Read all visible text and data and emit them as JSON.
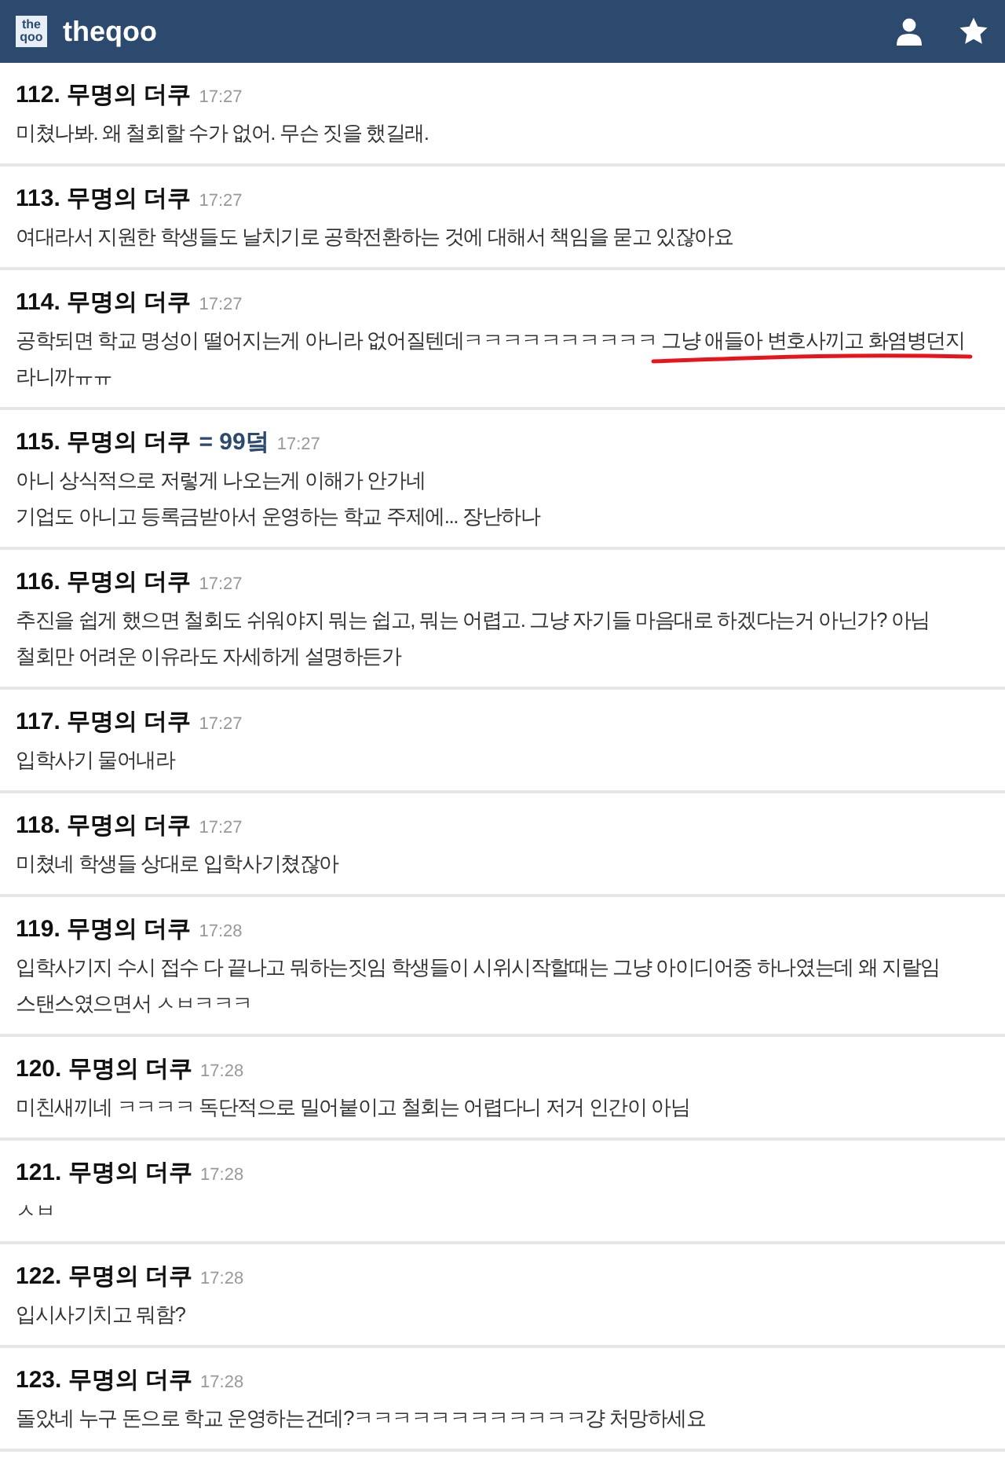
{
  "header": {
    "logo": "the qoo",
    "title": "theqoo"
  },
  "comments": [
    {
      "number": "112.",
      "author": "무명의 더쿠",
      "time": "17:27",
      "lines": [
        "미쳤나봐. 왜 철회할 수가 없어. 무슨 짓을 했길래."
      ]
    },
    {
      "number": "113.",
      "author": "무명의 더쿠",
      "time": "17:27",
      "lines": [
        "여대라서 지원한 학생들도 날치기로 공학전환하는 것에 대해서 책임을 묻고 있잖아요"
      ]
    },
    {
      "number": "114.",
      "author": "무명의 더쿠",
      "time": "17:27",
      "lines": [
        "공학되면 학교 명성이 떨어지는게 아니라 없어질텐데ㅋㅋㅋㅋㅋㅋㅋㅋㅋㅋ 그냥 애들아 변호사끼고 화염병던지",
        "라니까ㅠㅠ"
      ],
      "underlined": true
    },
    {
      "number": "115.",
      "author": "무명의 더쿠",
      "tag": "= 99덬",
      "time": "17:27",
      "lines": [
        "아니 상식적으로 저렇게 나오는게 이해가 안가네",
        "기업도 아니고 등록금받아서 운영하는 학교 주제에... 장난하나"
      ]
    },
    {
      "number": "116.",
      "author": "무명의 더쿠",
      "time": "17:27",
      "lines": [
        "추진을 쉽게 했으면 철회도 쉬워야지 뭐는 쉽고, 뭐는 어렵고. 그냥 자기들 마음대로 하겠다는거 아닌가? 아님",
        "철회만 어려운 이유라도 자세하게 설명하든가"
      ]
    },
    {
      "number": "117.",
      "author": "무명의 더쿠",
      "time": "17:27",
      "lines": [
        "입학사기 물어내라"
      ]
    },
    {
      "number": "118.",
      "author": "무명의 더쿠",
      "time": "17:27",
      "lines": [
        "미쳤네 학생들 상대로 입학사기쳤잖아"
      ]
    },
    {
      "number": "119.",
      "author": "무명의 더쿠",
      "time": "17:28",
      "lines": [
        "입학사기지 수시 접수 다 끝나고 뭐하는짓임 학생들이 시위시작할때는 그냥 아이디어중 하나였는데 왜 지랄임",
        "스탠스였으면서 ㅅㅂㅋㅋㅋ"
      ]
    },
    {
      "number": "120.",
      "author": "무명의 더쿠",
      "time": "17:28",
      "lines": [
        "미친새끼네 ㅋㅋㅋㅋ 독단적으로 밀어붙이고 철회는 어렵다니 저거 인간이 아님"
      ]
    },
    {
      "number": "121.",
      "author": "무명의 더쿠",
      "time": "17:28",
      "lines": [
        "ㅅㅂ"
      ]
    },
    {
      "number": "122.",
      "author": "무명의 더쿠",
      "time": "17:28",
      "lines": [
        "입시사기치고 뭐함?"
      ]
    },
    {
      "number": "123.",
      "author": "무명의 더쿠",
      "time": "17:28",
      "lines": [
        "돌았네 누구 돈으로 학교 운영하는건데?ㅋㅋㅋㅋㅋㅋㅋㅋㅋㅋㅋㅋ걍 처망하세요"
      ]
    }
  ]
}
